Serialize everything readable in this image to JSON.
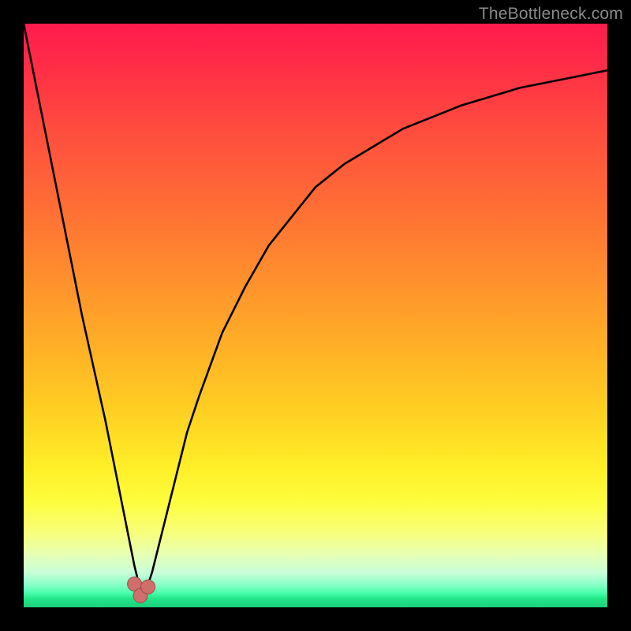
{
  "watermark": "TheBottleneck.com",
  "colors": {
    "frame": "#000000",
    "curve_stroke": "#000000",
    "marker_fill": "#cf6e6c",
    "marker_stroke": "#a24f4a",
    "watermark": "#8a8a8a",
    "gradient_stops": [
      "#ff1b4d",
      "#ff2f46",
      "#ff4c3f",
      "#ff6a36",
      "#ff8b2e",
      "#ffac27",
      "#ffce22",
      "#ffef28",
      "#fdfd3d",
      "#f9ff78",
      "#e7ffb4",
      "#c9ffd8",
      "#8dffc9",
      "#4cffae",
      "#22e789",
      "#1dcf7c"
    ]
  },
  "icons": {},
  "chart_data": {
    "type": "line",
    "title": "",
    "xlabel": "",
    "ylabel": "",
    "xlim": [
      0,
      100
    ],
    "ylim": [
      0,
      100
    ],
    "grid": false,
    "legend": false,
    "series": [
      {
        "name": "bottleneck-curve",
        "x": [
          0,
          2,
          4,
          6,
          8,
          10,
          12,
          14,
          16,
          18,
          19,
          20,
          21,
          22,
          24,
          26,
          28,
          30,
          34,
          38,
          42,
          46,
          50,
          55,
          60,
          65,
          70,
          75,
          80,
          85,
          90,
          95,
          100
        ],
        "y": [
          100,
          90,
          80,
          70,
          60,
          50,
          41,
          32,
          22,
          12,
          7,
          3,
          3,
          6,
          14,
          22,
          30,
          36,
          47,
          55,
          62,
          67,
          72,
          76,
          79,
          82,
          84,
          86,
          87.5,
          89,
          90,
          91,
          92
        ]
      }
    ],
    "markers": [
      {
        "name": "min-region-left",
        "x": 19,
        "y": 4
      },
      {
        "name": "min-region-mid",
        "x": 20,
        "y": 2
      },
      {
        "name": "min-region-right",
        "x": 21.3,
        "y": 3.5
      }
    ]
  }
}
